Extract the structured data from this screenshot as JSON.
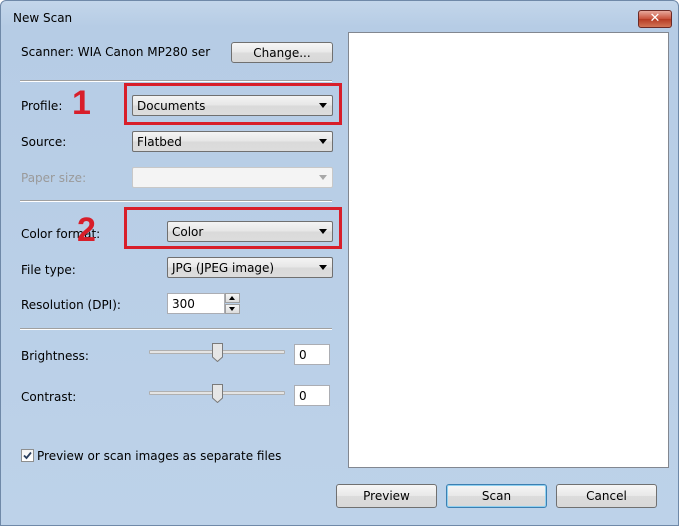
{
  "window": {
    "title": "New Scan",
    "close_glyph": "✕"
  },
  "scanner": {
    "label": "Scanner: WIA Canon MP280 ser",
    "change_button": "Change..."
  },
  "annotations": {
    "marker_1": "1",
    "marker_2": "2",
    "color": "#d81e2a"
  },
  "profile": {
    "label": "Profile:",
    "value": "Documents"
  },
  "source": {
    "label": "Source:",
    "value": "Flatbed"
  },
  "paper_size": {
    "label": "Paper size:",
    "value": "",
    "disabled": true
  },
  "color_format": {
    "label": "Color format:",
    "value": "Color"
  },
  "file_type": {
    "label": "File type:",
    "value": "JPG (JPEG image)"
  },
  "resolution": {
    "label": "Resolution (DPI):",
    "value": "300"
  },
  "brightness": {
    "label": "Brightness:",
    "value": "0",
    "level": 0
  },
  "contrast": {
    "label": "Contrast:",
    "value": "0",
    "level": 0
  },
  "separate_files": {
    "label": "Preview or scan images as separate files",
    "checked": true
  },
  "buttons": {
    "preview": "Preview",
    "scan": "Scan",
    "cancel": "Cancel"
  }
}
